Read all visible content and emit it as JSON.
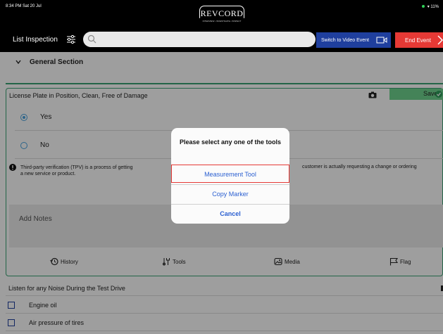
{
  "status_bar": {
    "time": "8:34 PM  Sat 20 Jul",
    "battery": "11%"
  },
  "logo": {
    "text": "REVCORD",
    "tagline": "INTERVIEW • INVESTIGATE • INSPECT"
  },
  "nav": {
    "title": "List Inspection",
    "search_placeholder": "",
    "video_button": "Switch to Video Event",
    "end_button": "End Event"
  },
  "general_section": {
    "title": "General Section"
  },
  "card": {
    "title": "License Plate in Position, Clean, Free of Damage",
    "saved": "Saved",
    "options": [
      {
        "label": "Yes",
        "selected": true
      },
      {
        "label": "No",
        "selected": false
      }
    ],
    "info_line1": "Third-party verification (TPV) is a process of getting",
    "info_line1_right": "customer is actually requesting a change or ordering",
    "info_line2": "a new service or product.",
    "notes_label": "Add Notes",
    "actions": {
      "history": "History",
      "tools": "Tools",
      "media": "Media",
      "flag": "Flag"
    }
  },
  "noise_section": {
    "title": "Listen for any Noise During the Test Drive"
  },
  "checklist": [
    {
      "label": "Engine oil"
    },
    {
      "label": "Air pressure of tires"
    }
  ],
  "dialog": {
    "title": "Please select any one of the tools",
    "items": [
      "Measurement Tool",
      "Copy Marker"
    ],
    "cancel": "Cancel"
  },
  "colors": {
    "accent_green": "#3aa374",
    "saved_green": "#6fd48f",
    "video_blue": "#1f3f9e",
    "end_red": "#e53935",
    "link_blue": "#2a5fd1"
  }
}
